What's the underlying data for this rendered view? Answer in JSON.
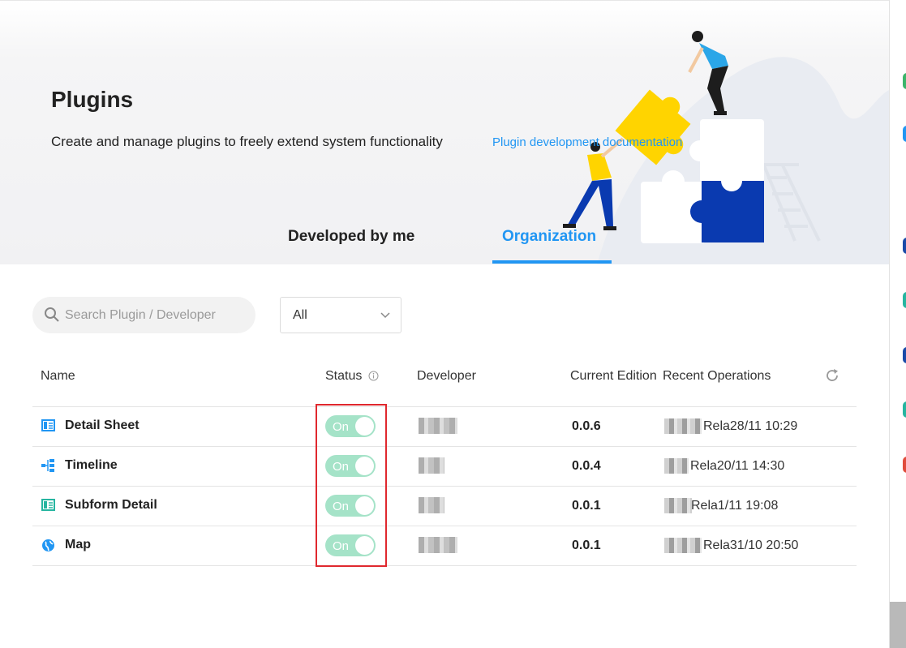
{
  "header": {
    "title": "Plugins",
    "subtitle": "Create and manage plugins to freely extend system functionality",
    "doc_link": "Plugin development documentation"
  },
  "tabs": [
    {
      "label": "Developed by me",
      "active": false
    },
    {
      "label": "Organization",
      "active": true
    }
  ],
  "filters": {
    "search_placeholder": "Search Plugin / Developer",
    "search_value": "",
    "scope_selected": "All"
  },
  "table": {
    "columns": {
      "name": "Name",
      "status": "Status",
      "developer": "Developer",
      "edition": "Current Edition",
      "operations": "Recent Operations"
    },
    "rows": [
      {
        "icon": "detail-sheet-icon",
        "name": "Detail Sheet",
        "status": "On",
        "edition": "0.0.6",
        "operation": "Rela28/11 10:29"
      },
      {
        "icon": "timeline-icon",
        "name": "Timeline",
        "status": "On",
        "edition": "0.0.4",
        "operation": "Rela20/11 14:30"
      },
      {
        "icon": "subform-detail-icon",
        "name": "Subform Detail",
        "status": "On",
        "edition": "0.0.1",
        "operation": "Rela1/11 19:08"
      },
      {
        "icon": "map-icon",
        "name": "Map",
        "status": "On",
        "edition": "0.0.1",
        "operation": "Rela31/10 20:50"
      }
    ]
  },
  "colors": {
    "accent": "#2196f3",
    "toggle_on": "#a5e3c8",
    "highlight": "#e0282e",
    "puzzle_yellow": "#ffd400",
    "puzzle_blue": "#0a3ab0"
  }
}
